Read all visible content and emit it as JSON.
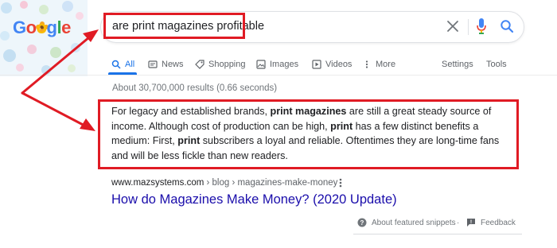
{
  "logo": {
    "text": [
      "G",
      "o",
      "o",
      "g",
      "l",
      "e"
    ],
    "icon": "google-doodle-logo"
  },
  "search": {
    "query": "are print magazines profitable",
    "icons": [
      "clear-icon",
      "mic-icon",
      "search-icon"
    ]
  },
  "tabs": [
    {
      "label": "All",
      "icon": "search-icon",
      "active": true
    },
    {
      "label": "News",
      "icon": "news-icon",
      "active": false
    },
    {
      "label": "Shopping",
      "icon": "tag-icon",
      "active": false
    },
    {
      "label": "Images",
      "icon": "image-icon",
      "active": false
    },
    {
      "label": "Videos",
      "icon": "video-icon",
      "active": false
    },
    {
      "label": "More",
      "icon": "more-vert-icon",
      "active": false
    }
  ],
  "tools": {
    "settings": "Settings",
    "tools": "Tools"
  },
  "stats": "About 30,700,000 results (0.66 seconds)",
  "snippet": {
    "p1": "For legacy and established brands, ",
    "b1": "print magazines",
    "p2": " are still a great steady source of income. Although cost of production can be high, ",
    "b2": "print",
    "p3": " has a few distinct benefits a medium: First, ",
    "b3": "print",
    "p4": " subscribers a loyal and reliable. Oftentimes they are long-time fans and will be less fickle than new readers."
  },
  "source": {
    "domain": "www.mazsystems.com",
    "breadcrumb": " › blog › magazines-make-money",
    "title": "How do Magazines Make Money? (2020 Update)"
  },
  "footer": {
    "about_snippets": "About featured snippets",
    "separator": "·",
    "feedback": "Feedback"
  },
  "colors": {
    "highlight": "#e01b24",
    "link": "#1a0dab",
    "active_tab": "#1a73e8",
    "google_blue": "#4285f4",
    "google_red": "#ea4335",
    "google_yellow": "#fbbc05",
    "google_green": "#34a853"
  }
}
